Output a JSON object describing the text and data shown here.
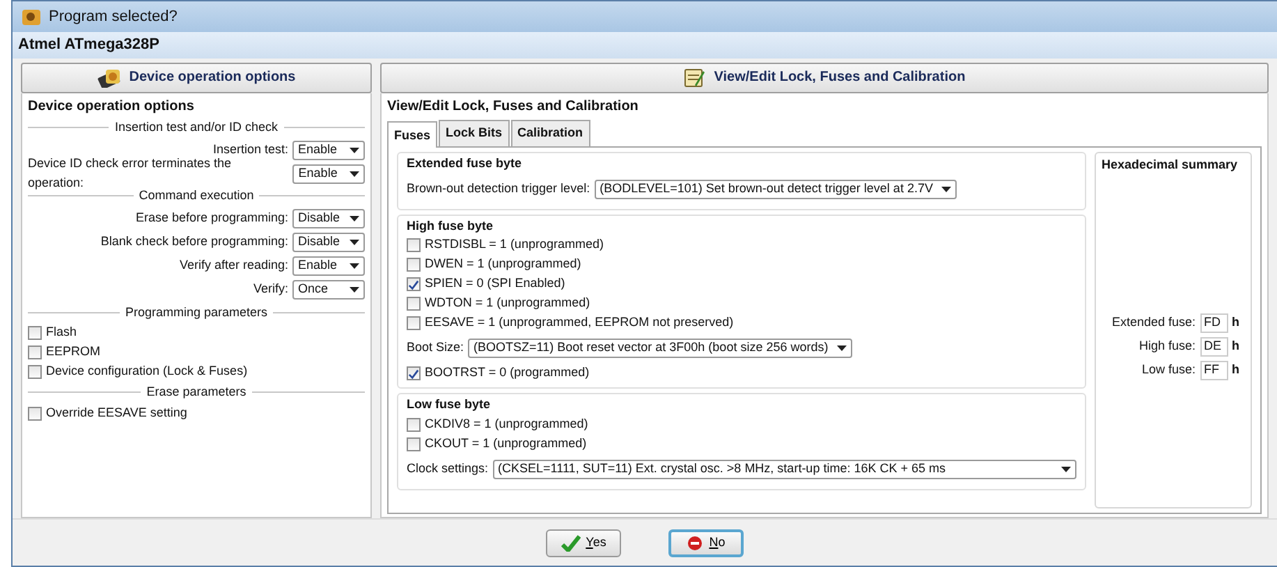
{
  "window": {
    "title": "Program selected?"
  },
  "device": "Atmel  ATmega328P",
  "left_panel": {
    "header": "Device operation options",
    "heading": "Device operation options",
    "sections": [
      {
        "title": "Insertion test and/or ID check",
        "rows": [
          {
            "kind": "select",
            "label": "Insertion test:",
            "value": "Enable"
          },
          {
            "kind": "select",
            "label": "Device ID check error terminates the operation:",
            "value": "Enable"
          }
        ]
      },
      {
        "title": "Command execution",
        "rows": [
          {
            "kind": "select",
            "label": "Erase before programming:",
            "value": "Disable"
          },
          {
            "kind": "select",
            "label": "Blank check before programming:",
            "value": "Disable"
          },
          {
            "kind": "select",
            "label": "Verify after reading:",
            "value": "Enable"
          },
          {
            "kind": "select",
            "label": "Verify:",
            "value": "Once"
          }
        ]
      },
      {
        "title": "Programming parameters",
        "rows": [
          {
            "kind": "checkbox",
            "label": "Flash",
            "checked": false
          },
          {
            "kind": "checkbox",
            "label": "EEPROM",
            "checked": false
          },
          {
            "kind": "checkbox",
            "label": "Device configuration (Lock & Fuses)",
            "checked": false
          }
        ]
      },
      {
        "title": "Erase parameters",
        "rows": [
          {
            "kind": "checkbox",
            "label": "Override EESAVE setting",
            "checked": false
          }
        ]
      }
    ]
  },
  "right_panel": {
    "header": "View/Edit Lock, Fuses and Calibration",
    "heading": "View/Edit Lock, Fuses and Calibration",
    "tabs": [
      {
        "label": "Fuses",
        "selected": true
      },
      {
        "label": "Lock Bits",
        "selected": false
      },
      {
        "label": "Calibration",
        "selected": false
      }
    ],
    "groups": [
      {
        "title": "Extended fuse byte",
        "rows": [
          {
            "kind": "select",
            "label": "Brown-out detection trigger level:",
            "value": "(BODLEVEL=101) Set brown-out detect trigger level at 2.7V",
            "wide": false
          }
        ]
      },
      {
        "title": "High fuse byte",
        "rows": [
          {
            "kind": "checkbox",
            "label": "RSTDISBL = 1 (unprogrammed)",
            "checked": false
          },
          {
            "kind": "checkbox",
            "label": "DWEN = 1 (unprogrammed)",
            "checked": false
          },
          {
            "kind": "checkbox",
            "label": "SPIEN = 0 (SPI Enabled)",
            "checked": true
          },
          {
            "kind": "checkbox",
            "label": "WDTON = 1 (unprogrammed)",
            "checked": false
          },
          {
            "kind": "checkbox",
            "label": "EESAVE = 1 (unprogrammed, EEPROM not preserved)",
            "checked": false
          },
          {
            "kind": "select",
            "label": "Boot Size:",
            "value": "(BOOTSZ=11) Boot reset vector at 3F00h (boot size 256 words)",
            "wide": false
          },
          {
            "kind": "checkbox",
            "label": "BOOTRST = 0 (programmed)",
            "checked": true
          }
        ]
      },
      {
        "title": "Low fuse byte",
        "rows": [
          {
            "kind": "checkbox",
            "label": "CKDIV8 = 1 (unprogrammed)",
            "checked": false
          },
          {
            "kind": "checkbox",
            "label": "CKOUT = 1 (unprogrammed)",
            "checked": false
          },
          {
            "kind": "select",
            "label": "Clock settings:",
            "value": "(CKSEL=1111, SUT=11) Ext. crystal osc. >8 MHz, start-up time: 16K CK + 65 ms",
            "wide": true
          }
        ]
      }
    ],
    "hex_summary": {
      "title": "Hexadecimal summary",
      "rows": [
        {
          "label": "Extended fuse:",
          "value": "FD",
          "unit": "h"
        },
        {
          "label": "High fuse:",
          "value": "DE",
          "unit": "h"
        },
        {
          "label": "Low fuse:",
          "value": "FF",
          "unit": "h"
        }
      ]
    }
  },
  "buttons": [
    {
      "kind": "yes",
      "label": "Yes"
    },
    {
      "kind": "no",
      "label": "No"
    }
  ]
}
